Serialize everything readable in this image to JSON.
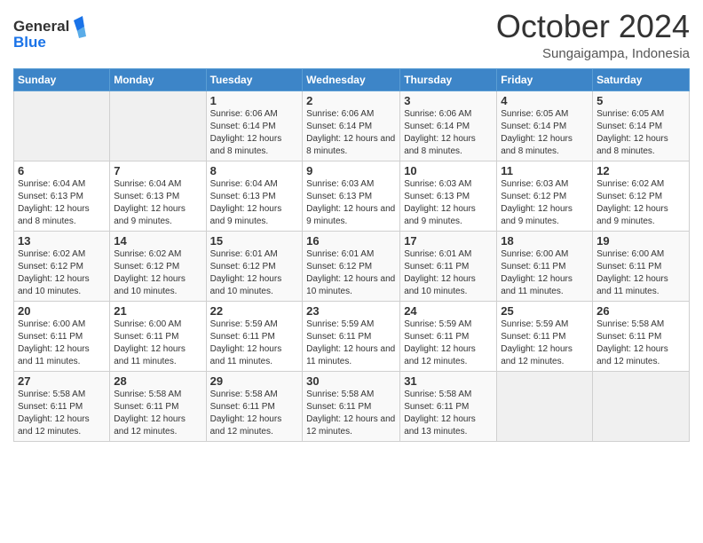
{
  "logo": {
    "line1": "General",
    "line2": "Blue"
  },
  "title": "October 2024",
  "location": "Sungaigampa, Indonesia",
  "days_of_week": [
    "Sunday",
    "Monday",
    "Tuesday",
    "Wednesday",
    "Thursday",
    "Friday",
    "Saturday"
  ],
  "weeks": [
    [
      {
        "day": "",
        "empty": true
      },
      {
        "day": "",
        "empty": true
      },
      {
        "day": "1",
        "sunrise": "Sunrise: 6:06 AM",
        "sunset": "Sunset: 6:14 PM",
        "daylight": "Daylight: 12 hours and 8 minutes."
      },
      {
        "day": "2",
        "sunrise": "Sunrise: 6:06 AM",
        "sunset": "Sunset: 6:14 PM",
        "daylight": "Daylight: 12 hours and 8 minutes."
      },
      {
        "day": "3",
        "sunrise": "Sunrise: 6:06 AM",
        "sunset": "Sunset: 6:14 PM",
        "daylight": "Daylight: 12 hours and 8 minutes."
      },
      {
        "day": "4",
        "sunrise": "Sunrise: 6:05 AM",
        "sunset": "Sunset: 6:14 PM",
        "daylight": "Daylight: 12 hours and 8 minutes."
      },
      {
        "day": "5",
        "sunrise": "Sunrise: 6:05 AM",
        "sunset": "Sunset: 6:14 PM",
        "daylight": "Daylight: 12 hours and 8 minutes."
      }
    ],
    [
      {
        "day": "6",
        "sunrise": "Sunrise: 6:04 AM",
        "sunset": "Sunset: 6:13 PM",
        "daylight": "Daylight: 12 hours and 8 minutes."
      },
      {
        "day": "7",
        "sunrise": "Sunrise: 6:04 AM",
        "sunset": "Sunset: 6:13 PM",
        "daylight": "Daylight: 12 hours and 9 minutes."
      },
      {
        "day": "8",
        "sunrise": "Sunrise: 6:04 AM",
        "sunset": "Sunset: 6:13 PM",
        "daylight": "Daylight: 12 hours and 9 minutes."
      },
      {
        "day": "9",
        "sunrise": "Sunrise: 6:03 AM",
        "sunset": "Sunset: 6:13 PM",
        "daylight": "Daylight: 12 hours and 9 minutes."
      },
      {
        "day": "10",
        "sunrise": "Sunrise: 6:03 AM",
        "sunset": "Sunset: 6:13 PM",
        "daylight": "Daylight: 12 hours and 9 minutes."
      },
      {
        "day": "11",
        "sunrise": "Sunrise: 6:03 AM",
        "sunset": "Sunset: 6:12 PM",
        "daylight": "Daylight: 12 hours and 9 minutes."
      },
      {
        "day": "12",
        "sunrise": "Sunrise: 6:02 AM",
        "sunset": "Sunset: 6:12 PM",
        "daylight": "Daylight: 12 hours and 9 minutes."
      }
    ],
    [
      {
        "day": "13",
        "sunrise": "Sunrise: 6:02 AM",
        "sunset": "Sunset: 6:12 PM",
        "daylight": "Daylight: 12 hours and 10 minutes."
      },
      {
        "day": "14",
        "sunrise": "Sunrise: 6:02 AM",
        "sunset": "Sunset: 6:12 PM",
        "daylight": "Daylight: 12 hours and 10 minutes."
      },
      {
        "day": "15",
        "sunrise": "Sunrise: 6:01 AM",
        "sunset": "Sunset: 6:12 PM",
        "daylight": "Daylight: 12 hours and 10 minutes."
      },
      {
        "day": "16",
        "sunrise": "Sunrise: 6:01 AM",
        "sunset": "Sunset: 6:12 PM",
        "daylight": "Daylight: 12 hours and 10 minutes."
      },
      {
        "day": "17",
        "sunrise": "Sunrise: 6:01 AM",
        "sunset": "Sunset: 6:11 PM",
        "daylight": "Daylight: 12 hours and 10 minutes."
      },
      {
        "day": "18",
        "sunrise": "Sunrise: 6:00 AM",
        "sunset": "Sunset: 6:11 PM",
        "daylight": "Daylight: 12 hours and 11 minutes."
      },
      {
        "day": "19",
        "sunrise": "Sunrise: 6:00 AM",
        "sunset": "Sunset: 6:11 PM",
        "daylight": "Daylight: 12 hours and 11 minutes."
      }
    ],
    [
      {
        "day": "20",
        "sunrise": "Sunrise: 6:00 AM",
        "sunset": "Sunset: 6:11 PM",
        "daylight": "Daylight: 12 hours and 11 minutes."
      },
      {
        "day": "21",
        "sunrise": "Sunrise: 6:00 AM",
        "sunset": "Sunset: 6:11 PM",
        "daylight": "Daylight: 12 hours and 11 minutes."
      },
      {
        "day": "22",
        "sunrise": "Sunrise: 5:59 AM",
        "sunset": "Sunset: 6:11 PM",
        "daylight": "Daylight: 12 hours and 11 minutes."
      },
      {
        "day": "23",
        "sunrise": "Sunrise: 5:59 AM",
        "sunset": "Sunset: 6:11 PM",
        "daylight": "Daylight: 12 hours and 11 minutes."
      },
      {
        "day": "24",
        "sunrise": "Sunrise: 5:59 AM",
        "sunset": "Sunset: 6:11 PM",
        "daylight": "Daylight: 12 hours and 12 minutes."
      },
      {
        "day": "25",
        "sunrise": "Sunrise: 5:59 AM",
        "sunset": "Sunset: 6:11 PM",
        "daylight": "Daylight: 12 hours and 12 minutes."
      },
      {
        "day": "26",
        "sunrise": "Sunrise: 5:58 AM",
        "sunset": "Sunset: 6:11 PM",
        "daylight": "Daylight: 12 hours and 12 minutes."
      }
    ],
    [
      {
        "day": "27",
        "sunrise": "Sunrise: 5:58 AM",
        "sunset": "Sunset: 6:11 PM",
        "daylight": "Daylight: 12 hours and 12 minutes."
      },
      {
        "day": "28",
        "sunrise": "Sunrise: 5:58 AM",
        "sunset": "Sunset: 6:11 PM",
        "daylight": "Daylight: 12 hours and 12 minutes."
      },
      {
        "day": "29",
        "sunrise": "Sunrise: 5:58 AM",
        "sunset": "Sunset: 6:11 PM",
        "daylight": "Daylight: 12 hours and 12 minutes."
      },
      {
        "day": "30",
        "sunrise": "Sunrise: 5:58 AM",
        "sunset": "Sunset: 6:11 PM",
        "daylight": "Daylight: 12 hours and 12 minutes."
      },
      {
        "day": "31",
        "sunrise": "Sunrise: 5:58 AM",
        "sunset": "Sunset: 6:11 PM",
        "daylight": "Daylight: 12 hours and 13 minutes."
      },
      {
        "day": "",
        "empty": true
      },
      {
        "day": "",
        "empty": true
      }
    ]
  ]
}
